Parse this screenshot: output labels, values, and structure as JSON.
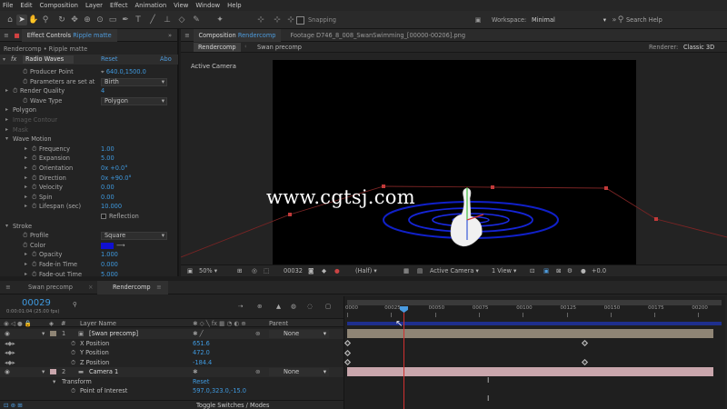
{
  "menu": [
    "File",
    "Edit",
    "Composition",
    "Layer",
    "Effect",
    "Animation",
    "View",
    "Window",
    "Help"
  ],
  "toolbar": {
    "snapping": "Snapping",
    "workspace_label": "Workspace:",
    "workspace_value": "Minimal",
    "search_help": "Search Help"
  },
  "effect_controls": {
    "tab_title": "Effect Controls",
    "tab_layer": "Ripple matte",
    "crumb": "Rendercomp • Ripple matte",
    "effect_name": "Radio Waves",
    "reset": "Reset",
    "about": "Abo",
    "rows": [
      {
        "label": "Producer Point",
        "value": "640.0,1500.0"
      },
      {
        "label": "Parameters are set at",
        "value": "Birth"
      },
      {
        "label": "Render Quality",
        "value": "4"
      },
      {
        "label": "Wave Type",
        "value": "Polygon"
      },
      {
        "label": "Polygon",
        "value": ""
      },
      {
        "label": "Image Contour",
        "value": ""
      },
      {
        "label": "Mask",
        "value": ""
      },
      {
        "label": "Wave Motion",
        "value": ""
      },
      {
        "label": "Frequency",
        "value": "1.00"
      },
      {
        "label": "Expansion",
        "value": "5.00"
      },
      {
        "label": "Orientation",
        "value": "0x +0.0°"
      },
      {
        "label": "Direction",
        "value": "0x +90.0°"
      },
      {
        "label": "Velocity",
        "value": "0.00"
      },
      {
        "label": "Spin",
        "value": "0.00"
      },
      {
        "label": "Lifespan (sec)",
        "value": "10.000"
      },
      {
        "label": "Reflection",
        "value": ""
      },
      {
        "label": "Stroke",
        "value": ""
      },
      {
        "label": "Profile",
        "value": "Square"
      },
      {
        "label": "Color",
        "value": ""
      },
      {
        "label": "Opacity",
        "value": "1.000"
      },
      {
        "label": "Fade-in Time",
        "value": "0.000"
      },
      {
        "label": "Fade-out Time",
        "value": "5.000"
      }
    ]
  },
  "composition": {
    "tab_title": "Composition",
    "tab_name": "Rendercomp",
    "footage_tab": "Footage D746_8_008_SwanSwimming_[00000-00206].png",
    "sub_tabs": [
      "Rendercomp",
      "Swan precomp"
    ],
    "renderer_label": "Renderer:",
    "renderer_value": "Classic 3D",
    "active_camera": "Active Camera",
    "watermark": "www.cgtsj.com",
    "footer": {
      "zoom": "50%",
      "frame": "00032",
      "resolution": "(Half)",
      "camera": "Active Camera",
      "view": "1 View",
      "exposure": "+0.0"
    }
  },
  "timeline": {
    "tabs": [
      "Swan precomp",
      "Rendercomp"
    ],
    "timecode": "00029",
    "timecode_sub": "0:00:01:04 (25.00 fps)",
    "col_num": "#",
    "col_layer": "Layer Name",
    "col_parent": "Parent",
    "ruler": [
      "0000",
      "00025",
      "00050",
      "00075",
      "00100",
      "00125",
      "00150",
      "00175",
      "00200"
    ],
    "layers": [
      {
        "num": "1",
        "name": "[Swan precomp]",
        "parent": "None"
      },
      {
        "prop": "X Position",
        "value": "651.6"
      },
      {
        "prop": "Y Position",
        "value": "472.0"
      },
      {
        "prop": "Z Position",
        "value": "-184.4"
      },
      {
        "num": "2",
        "name": "Camera 1",
        "parent": "None"
      },
      {
        "prop": "Transform",
        "value": "Reset"
      },
      {
        "prop": "Point of Interest",
        "value": "597.0,323.0,-15.0"
      }
    ],
    "toggle": "Toggle Switches / Modes"
  },
  "colors": {
    "accent": "#4e9bdc",
    "stroke_color": "#1010d0",
    "layer1_bar": "#8f8575",
    "layer2_bar": "#c9a6ac",
    "playhead": "#d03030"
  }
}
